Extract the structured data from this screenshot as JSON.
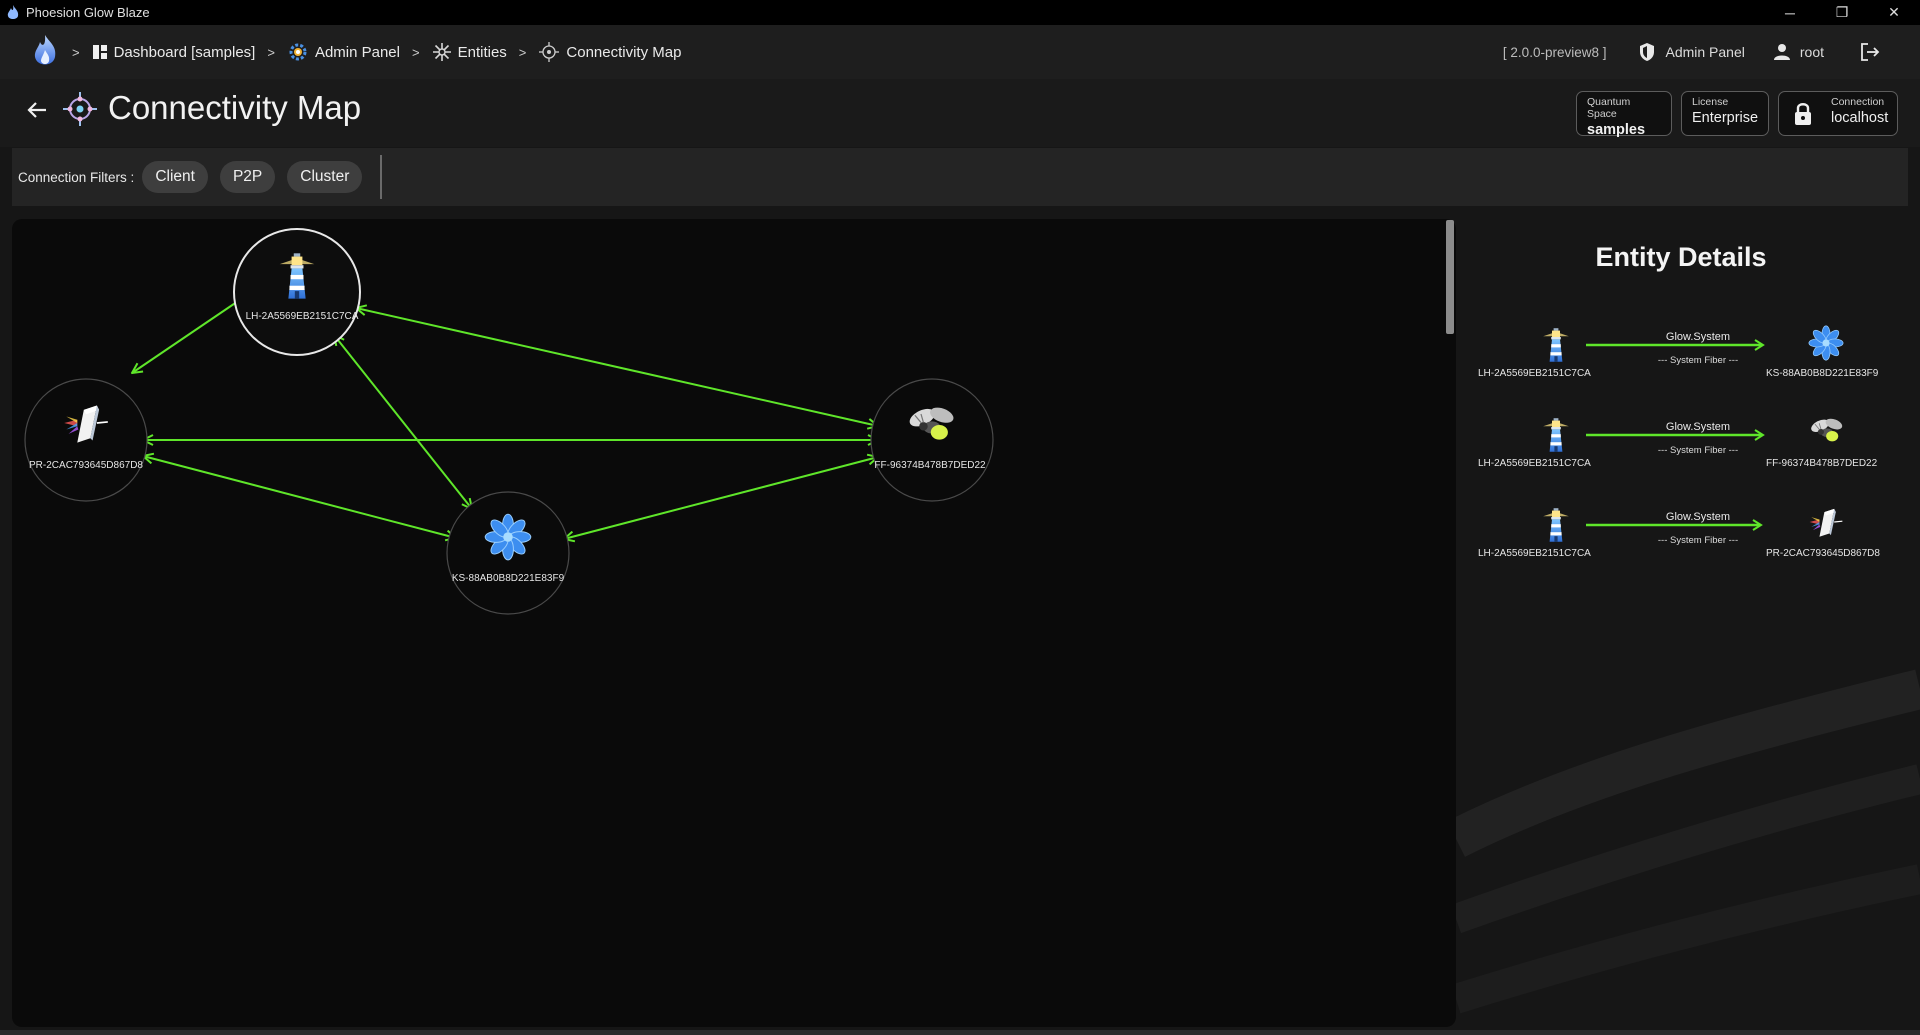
{
  "window": {
    "title": "Phoesion Glow Blaze",
    "minimize": "─",
    "restore": "❐",
    "close": "✕"
  },
  "breadcrumb": {
    "separator": ">",
    "items": [
      {
        "label": "Dashboard [samples]"
      },
      {
        "label": "Admin Panel"
      },
      {
        "label": "Entities"
      },
      {
        "label": "Connectivity Map"
      }
    ]
  },
  "nav_right": {
    "version": "[ 2.0.0-preview8 ]",
    "admin_panel": "Admin Panel",
    "user": "root"
  },
  "header": {
    "title": "Connectivity Map",
    "quantum_space": {
      "label": "Quantum Space",
      "value": "samples"
    },
    "license": {
      "label": "License",
      "value": "Enterprise"
    },
    "connection": {
      "label": "Connection",
      "value": "localhost"
    }
  },
  "filters": {
    "label": "Connection Filters :",
    "chips": [
      "Client",
      "P2P",
      "Cluster"
    ]
  },
  "map": {
    "nodes": [
      {
        "id": "lighthouse",
        "label": "LH-2A5569EB2151C7CA",
        "icon": "lighthouse-icon",
        "selected": true
      },
      {
        "id": "prism",
        "label": "PR-2CAC793645D867D8",
        "icon": "prism-icon",
        "selected": false
      },
      {
        "id": "firefly",
        "label": "FF-96374B478B7DED22",
        "icon": "firefly-icon",
        "selected": false
      },
      {
        "id": "kaleidoscope",
        "label": "KS-88AB0B8D221E83F9",
        "icon": "kaleidoscope-icon",
        "selected": false
      }
    ],
    "edge_color": "#5fe62a"
  },
  "details": {
    "title": "Entity Details",
    "connections": [
      {
        "source": "LH-2A5569EB2151C7CA",
        "target": "KS-88AB0B8D221E83F9",
        "relation": "Glow.System",
        "channel": "--- System Fiber ---",
        "source_icon": "lighthouse-icon",
        "target_icon": "kaleidoscope-icon"
      },
      {
        "source": "LH-2A5569EB2151C7CA",
        "target": "FF-96374B478B7DED22",
        "relation": "Glow.System",
        "channel": "--- System Fiber ---",
        "source_icon": "lighthouse-icon",
        "target_icon": "firefly-icon"
      },
      {
        "source": "LH-2A5569EB2151C7CA",
        "target": "PR-2CAC793645D867D8",
        "relation": "Glow.System",
        "channel": "--- System Fiber ---",
        "source_icon": "lighthouse-icon",
        "target_icon": "prism-icon"
      }
    ]
  }
}
